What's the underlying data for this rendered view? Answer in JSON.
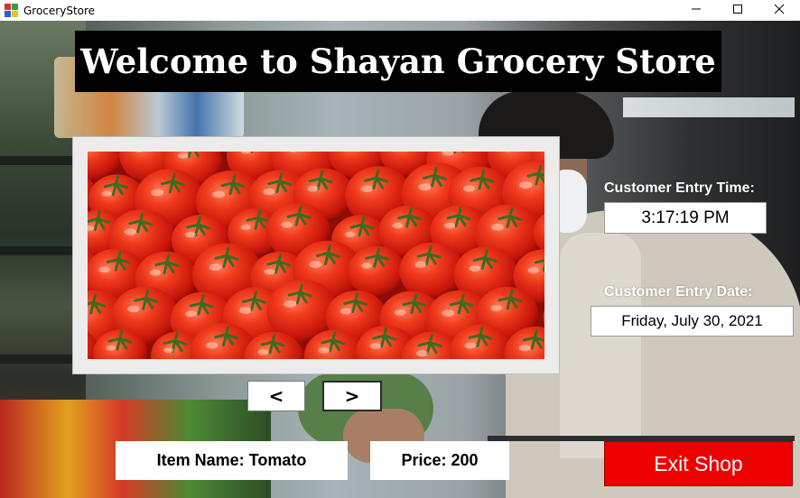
{
  "window": {
    "title": "GroceryStore",
    "controls": [
      "minimize-icon",
      "maximize-icon",
      "close-icon"
    ]
  },
  "header": {
    "welcome_text": "Welcome to Shayan Grocery Store"
  },
  "gallery": {
    "image_subject": "tomatoes",
    "prev_label": "<",
    "next_label": ">"
  },
  "item": {
    "name_text": "Item Name: Tomato",
    "price_text": "Price: 200"
  },
  "entry": {
    "time_caption": "Customer Entry Time:",
    "time_value": "3:17:19 PM",
    "date_caption": "Customer Entry Date:",
    "date_value": "Friday, July 30, 2021"
  },
  "actions": {
    "exit_label": "Exit Shop"
  },
  "colors": {
    "exit_button": "#ee0000",
    "title_bar_bg": "#000000",
    "tomato_red": "#d8200f"
  }
}
